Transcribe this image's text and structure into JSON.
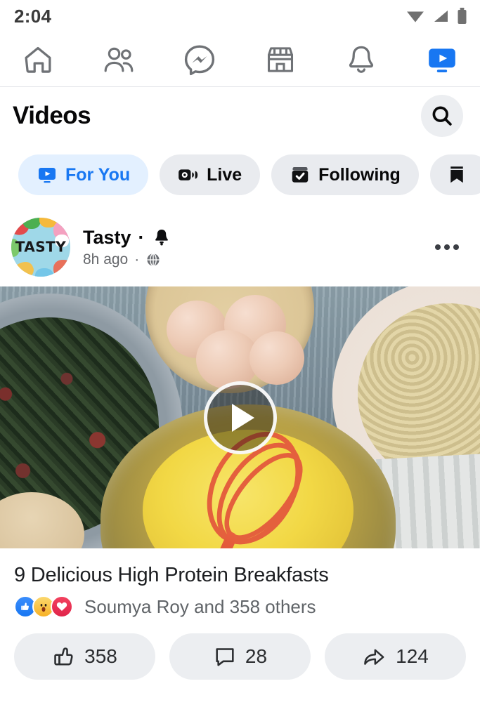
{
  "status_bar": {
    "time": "2:04",
    "icons": [
      "wifi-icon",
      "cellular-signal-icon",
      "battery-icon"
    ]
  },
  "top_nav": {
    "items": [
      {
        "name": "home-icon",
        "label": "Home",
        "active": false
      },
      {
        "name": "friends-icon",
        "label": "Friends",
        "active": false
      },
      {
        "name": "messenger-icon",
        "label": "Messenger",
        "active": false
      },
      {
        "name": "marketplace-icon",
        "label": "Marketplace",
        "active": false
      },
      {
        "name": "notifications-bell-icon",
        "label": "Notifications",
        "active": false
      },
      {
        "name": "video-icon",
        "label": "Video",
        "active": true
      }
    ],
    "active_color": "#1877f2"
  },
  "header": {
    "title": "Videos",
    "search_icon": "search-icon"
  },
  "filters": {
    "chips": [
      {
        "label": "For You",
        "icon": "video-monitor-icon",
        "active": true
      },
      {
        "label": "Live",
        "icon": "live-camera-icon",
        "active": false
      },
      {
        "label": "Following",
        "icon": "following-check-icon",
        "active": false
      },
      {
        "label": "",
        "icon": "saved-bookmark-icon",
        "active": false
      }
    ],
    "active_bg": "#e3f0ff",
    "active_fg": "#1877f2",
    "inactive_bg": "#e9ebef"
  },
  "post": {
    "author": "Tasty",
    "author_separator": "·",
    "avatar_text": "TASTY",
    "bell_icon": "notification-bell-icon",
    "timestamp": "8h ago",
    "timestamp_separator": "·",
    "privacy_icon": "globe-public-icon",
    "more_icon": "more-options-icon",
    "video": {
      "play_icon": "play-button-icon",
      "title": "9 Delicious High Protein Breakfasts"
    },
    "reactions": {
      "icons": [
        "like-reaction",
        "wow-reaction",
        "love-reaction"
      ],
      "summary": "Soumya Roy and 358 others"
    },
    "actions": [
      {
        "icon": "thumbs-up-icon",
        "count": "358",
        "name": "like-button"
      },
      {
        "icon": "comment-icon",
        "count": "28",
        "name": "comment-button"
      },
      {
        "icon": "share-icon",
        "count": "124",
        "name": "share-button"
      }
    ]
  }
}
